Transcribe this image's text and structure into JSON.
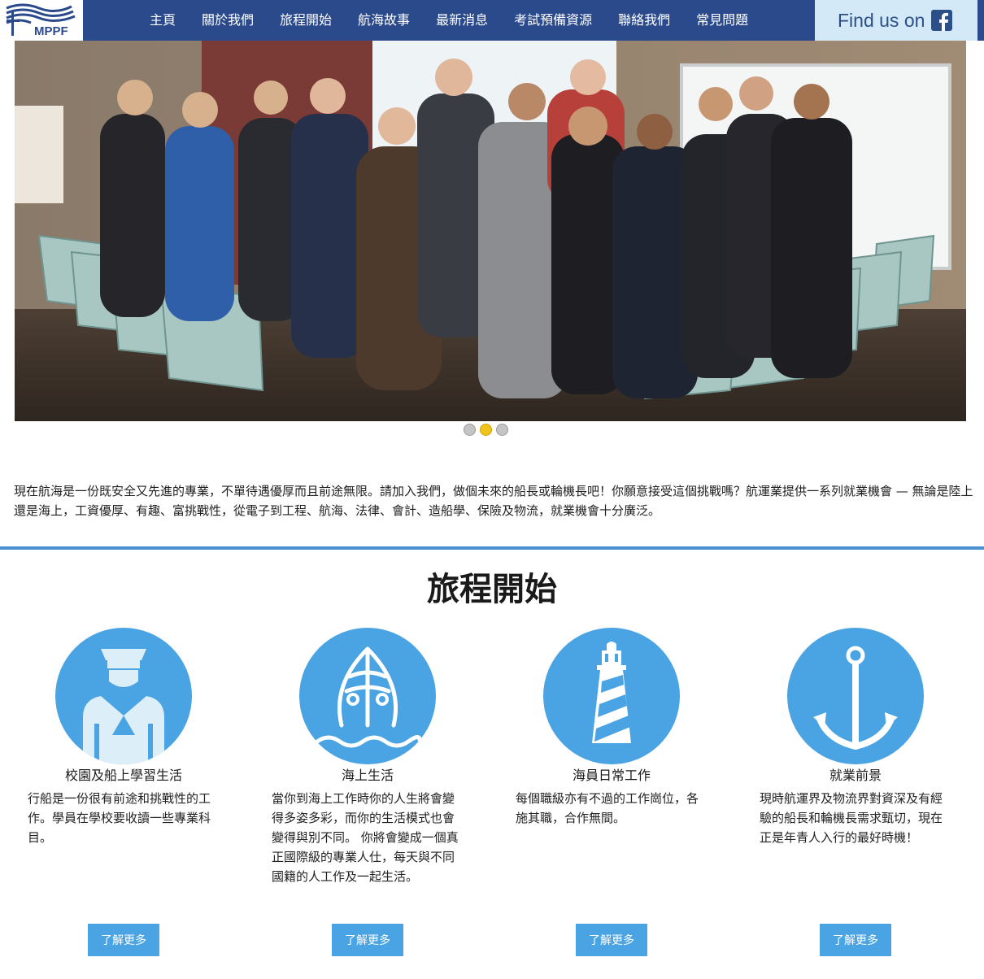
{
  "header": {
    "logo_text": "MPPF",
    "nav": [
      "主頁",
      "關於我們",
      "旅程開始",
      "航海故事",
      "最新消息",
      "考試預備資源",
      "聯絡我們",
      "常見問題"
    ],
    "facebook_label": "Find us on"
  },
  "hero": {
    "slides": 3,
    "active_slide": 2
  },
  "intro": {
    "text": "現在航海是一份既安全又先進的專業，不單待遇優厚而且前途無限。請加入我們，做個未來的船長或輪機長吧！你願意接受這個挑戰嗎？航運業提供一系列就業機會 — 無論是陸上還是海上，工資優厚、有趣、富挑戰性，從電子到工程、航海、法律、會計、造船學、保險及物流，就業機會十分廣泛。"
  },
  "section": {
    "title": "旅程開始",
    "cards": [
      {
        "icon": "sailor-icon",
        "title": "校園及船上學習生活",
        "text": "行船是一份很有前途和挑戰性的工作。學員在學校要收讀一些專業科目。",
        "button": "了解更多"
      },
      {
        "icon": "ship-icon",
        "title": "海上生活",
        "text": "當你到海上工作時你的人生將會變得多姿多彩，而你的生活模式也會變得與別不同。 你將會變成一個真正國際級的專業人仕，每天與不同國籍的人工作及一起生活。",
        "button": "了解更多"
      },
      {
        "icon": "lighthouse-icon",
        "title": "海員日常工作",
        "text": "每個職級亦有不過的工作崗位，各施其職，合作無間。",
        "button": "了解更多"
      },
      {
        "icon": "anchor-icon",
        "title": "就業前景",
        "text": "現時航運界及物流界對資深及有經驗的船長和輪機長需求甄切，現在正是年青人入行的最好時機！",
        "button": "了解更多"
      }
    ]
  },
  "colors": {
    "header_bg": "#2a4a8c",
    "accent": "#4aa3e3",
    "divider": "#4a90d2",
    "facebook_bg": "#d3e9f7",
    "active_dot": "#f2c318"
  }
}
